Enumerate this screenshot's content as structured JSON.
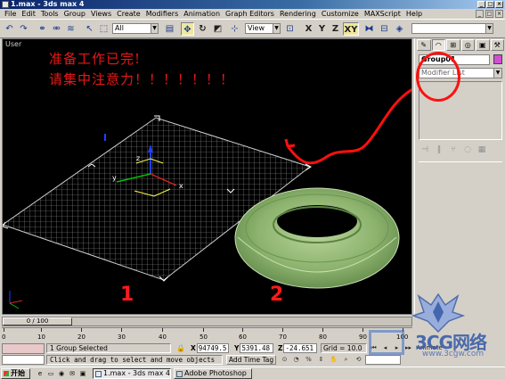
{
  "window": {
    "title": "1.max - 3ds max 4",
    "controls": [
      "_",
      "□",
      "×"
    ]
  },
  "menu": [
    "File",
    "Edit",
    "Tools",
    "Group",
    "Views",
    "Create",
    "Modifiers",
    "Animation",
    "Graph Editors",
    "Rendering",
    "Customize",
    "MAXScript",
    "Help"
  ],
  "toolbar": {
    "selection_filter": "All",
    "ref_coord_system": "View",
    "axis_buttons": [
      "X",
      "Y",
      "Z",
      "XY"
    ],
    "icons": [
      "undo-icon",
      "redo-icon",
      "link-icon",
      "unlink-icon",
      "bind-space-warp-icon",
      "select-icon",
      "region-select-icon",
      "select-by-name-icon",
      "move-icon",
      "rotate-icon",
      "scale-icon",
      "pivot-icon",
      "mirror-icon",
      "align-icon",
      "render-icon"
    ]
  },
  "viewport": {
    "label": "User",
    "note_line1": "准备工作已完!",
    "note_line2": "请集中注意力！！！！！！！",
    "label_1": "1",
    "label_2": "2"
  },
  "command_panel": {
    "object_name": "Group01",
    "modifier_list": "Modifier List",
    "name_color": "#d24fd2"
  },
  "timeline": {
    "slider": "0 / 100",
    "ticks": [
      "0",
      "10",
      "20",
      "30",
      "40",
      "50",
      "60",
      "70",
      "80",
      "90",
      "100"
    ]
  },
  "status": {
    "selection": "1 Group Selected",
    "prompt": "Click and drag to select and move objects",
    "x": "94749.5",
    "y": "5391.48",
    "z": "-24.651",
    "grid": "Grid = 10.0",
    "time_tag": "Add Time Tag",
    "animate": "Animate"
  },
  "taskbar": {
    "start": "开始",
    "tasks": [
      "1.max - 3ds max 4",
      "Adobe Photoshop"
    ]
  },
  "watermark": {
    "text": "3CG网络",
    "sub": "www.3cgw.com"
  }
}
